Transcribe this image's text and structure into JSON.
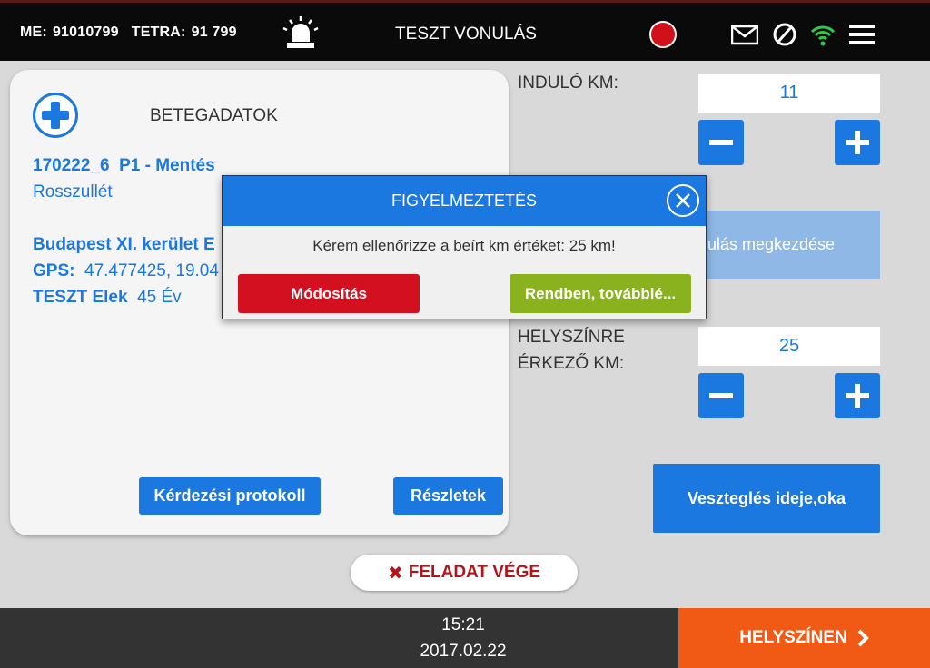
{
  "topbar": {
    "me_label": "ME:",
    "me_value": "91010799",
    "tetra_label": "TETRA:",
    "tetra_value": "91 799",
    "title": "TESZT VONULÁS",
    "icons": [
      "siren-icon",
      "record-indicator",
      "mail-icon",
      "blocked-icon",
      "wifi-icon",
      "menu-icon"
    ]
  },
  "patient": {
    "heading": "BETEGADATOK",
    "case_id": "170222_6",
    "priority": "P1 - Mentés",
    "complaint": "Rosszullét",
    "address": "Budapest XI. kerület E",
    "gps_label": "GPS:",
    "gps_value": "47.477425, 19.04",
    "name": "TESZT Elek",
    "age": "45 Év",
    "protocol_button": "Kérdezési protokoll",
    "details_button": "Részletek"
  },
  "km": {
    "start_label": "INDULÓ KM:",
    "start_value": "11",
    "start_button": "nulás megkezdése",
    "arrive_label_line1": "HELYSZÍNRE",
    "arrive_label_line2": "ÉRKEZŐ KM:",
    "arrive_value": "25",
    "delay_button": "Veszteglés ideje,oka"
  },
  "end_task": {
    "label": "FELADAT VÉGE",
    "icon": "x-icon"
  },
  "bottombar": {
    "time": "15:21",
    "date": "2017.02.22",
    "onsite_button": "HELYSZÍNEN"
  },
  "dialog": {
    "title": "FIGYELMEZTETÉS",
    "message": "Kérem ellenőrizze a beírt km értéket: 25 km!",
    "modify_button": "Módosítás",
    "ok_button": "Rendben, továbblé..."
  },
  "colors": {
    "accent": "#1a78e0",
    "danger": "#d2101f",
    "ok": "#8ab21e",
    "onsite": "#f05a14",
    "start_disabled": "#8fb8e6"
  }
}
